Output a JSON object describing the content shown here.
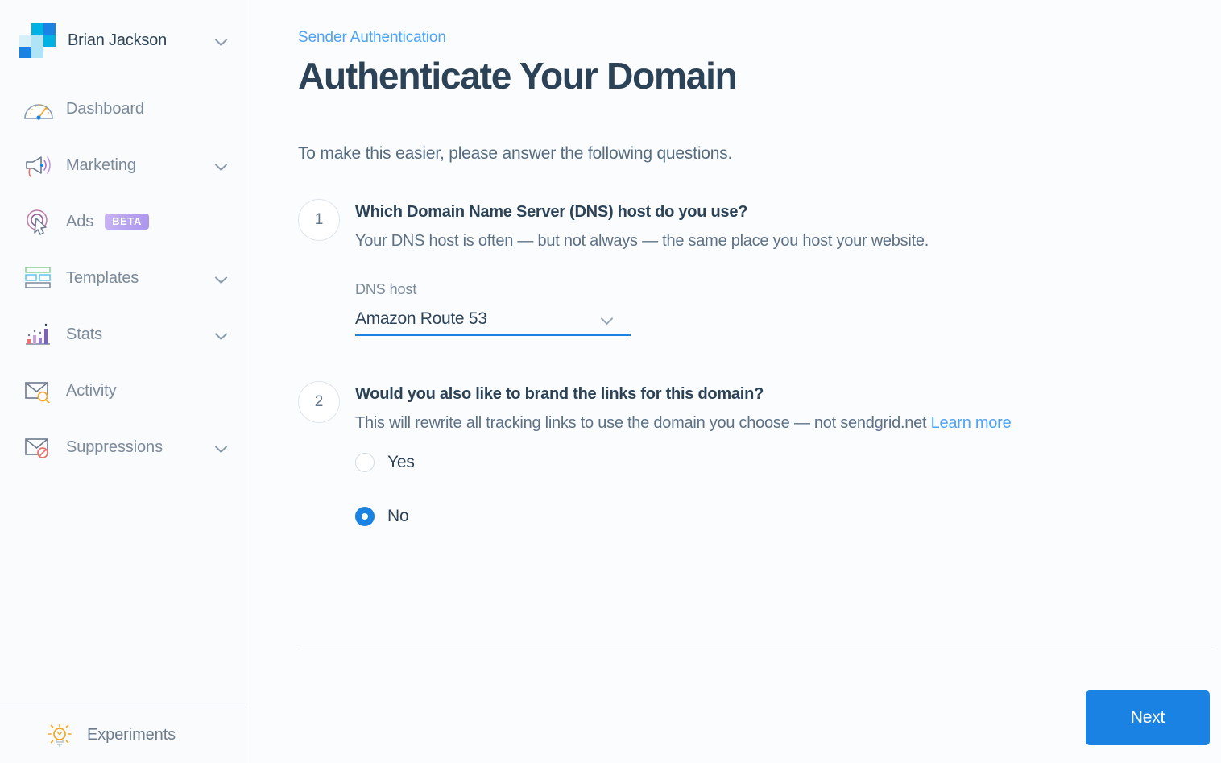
{
  "sidebar": {
    "account": {
      "name": "Brian Jackson",
      "logo_icon": "sendgrid-logo-icon",
      "chevron_icon": "chevron-down-icon",
      "colors": {
        "cyan": "#00b2e3",
        "blue": "#1a82e2",
        "light_cyan": "#aee4f5",
        "pale_cyan": "#d6f0fa"
      }
    },
    "items": [
      {
        "label": "Dashboard",
        "icon": "gauge-icon",
        "expandable": false,
        "badge": null
      },
      {
        "label": "Marketing",
        "icon": "megaphone-icon",
        "expandable": true,
        "badge": null
      },
      {
        "label": "Ads",
        "icon": "ad-cursor-icon",
        "expandable": false,
        "badge": "BETA"
      },
      {
        "label": "Templates",
        "icon": "templates-icon",
        "expandable": true,
        "badge": null
      },
      {
        "label": "Stats",
        "icon": "bar-chart-icon",
        "expandable": true,
        "badge": null
      },
      {
        "label": "Activity",
        "icon": "envelope-search-icon",
        "expandable": false,
        "badge": null
      },
      {
        "label": "Suppressions",
        "icon": "envelope-block-icon",
        "expandable": true,
        "badge": null
      }
    ],
    "footer": {
      "label": "Experiments",
      "icon": "lightbulb-icon"
    }
  },
  "main": {
    "breadcrumb": "Sender Authentication",
    "title": "Authenticate Your Domain",
    "intro": "To make this easier, please answer the following questions.",
    "questions": [
      {
        "number": "1",
        "title": "Which Domain Name Server (DNS) host do you use?",
        "subtitle": "Your DNS host is often — but not always — the same place you host your website.",
        "field": {
          "label": "DNS host",
          "value": "Amazon Route 53",
          "chevron_icon": "chevron-down-icon",
          "underline_color": "#1a82e2"
        }
      },
      {
        "number": "2",
        "title": "Would you also like to brand the links for this domain?",
        "subtitle_text": "This will rewrite all tracking links to use the domain you choose — not sendgrid.net ",
        "subtitle_link": "Learn more",
        "options": [
          {
            "label": "Yes",
            "selected": false
          },
          {
            "label": "No",
            "selected": true
          }
        ]
      }
    ],
    "next_label": "Next",
    "accent_color": "#1a82e2",
    "link_color": "#4fa3f7"
  }
}
